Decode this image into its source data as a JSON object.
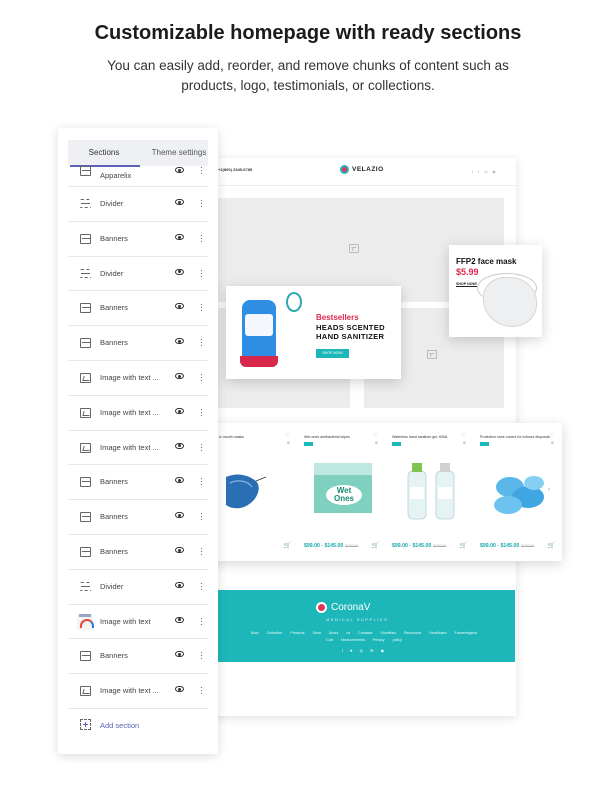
{
  "hero": {
    "title": "Customizable homepage with ready sections",
    "subtitle": "You can easily add, reorder, and remove chunks of content such as products, logo, testimonials, or collections."
  },
  "panel": {
    "tabs": [
      {
        "label": "Sections",
        "active": true
      },
      {
        "label": "Theme settings",
        "active": false
      }
    ],
    "sections": [
      {
        "label": "Apparelix",
        "icon": "banner-icon"
      },
      {
        "label": "Divider",
        "icon": "divider-icon"
      },
      {
        "label": "Banners",
        "icon": "banner-icon"
      },
      {
        "label": "Divider",
        "icon": "divider-icon"
      },
      {
        "label": "Banners",
        "icon": "banner-icon"
      },
      {
        "label": "Banners",
        "icon": "banner-icon"
      },
      {
        "label": "Image with text ...",
        "icon": "image-text-icon"
      },
      {
        "label": "Image with text ...",
        "icon": "image-text-icon"
      },
      {
        "label": "Image with text ...",
        "icon": "image-text-icon"
      },
      {
        "label": "Banners",
        "icon": "banner-icon"
      },
      {
        "label": "Banners",
        "icon": "banner-icon"
      },
      {
        "label": "Banners",
        "icon": "banner-icon"
      },
      {
        "label": "Divider",
        "icon": "divider-icon"
      },
      {
        "label": "Image with text",
        "icon": "colorful-image-icon"
      },
      {
        "label": "Banners",
        "icon": "banner-icon"
      },
      {
        "label": "Image with text ...",
        "icon": "image-text-icon"
      }
    ],
    "add_section_label": "Add section",
    "accent_color": "#5a64b8"
  },
  "site": {
    "phone": "+1(800) 2345-6789",
    "logo_text": "VELAZIO",
    "social": "f  t  ◎  ▶",
    "promo": {
      "kicker": "Bestsellers",
      "title": "HEADS SCENTED HAND SANITIZER",
      "button": "SHOP NOW!"
    },
    "mask": {
      "title": "FFP2 face mask",
      "price": "$5.99",
      "link": "SHOP NOW!"
    },
    "products": [
      {
        "name": "...ic mouth masks",
        "price": "",
        "old_price": ""
      },
      {
        "name": "Wet ones antibacterial wipes",
        "price": "$99.00 - $145.00",
        "old_price": "$120.00"
      },
      {
        "name": "Waterless hand sanitizer gel, 60ML",
        "price": "$99.00 - $145.00",
        "old_price": "$120.00"
      },
      {
        "name": "Protective shoe covers for indoors disposable",
        "price": "$99.00 - $145.00",
        "old_price": "$120.00"
      }
    ],
    "footer": {
      "brand": "CoronaV",
      "tagline": "MEDICAL SUPPLIES",
      "links": "Main Collection Products Store About us Contacts Shortlinks Resources Healthcare Faceeringlens Cart Measurements Privacy policy",
      "social": "f ♥ ◎ ✉ ◉"
    },
    "teal_color": "#1eb7b9",
    "pink_color": "#e0284f"
  }
}
